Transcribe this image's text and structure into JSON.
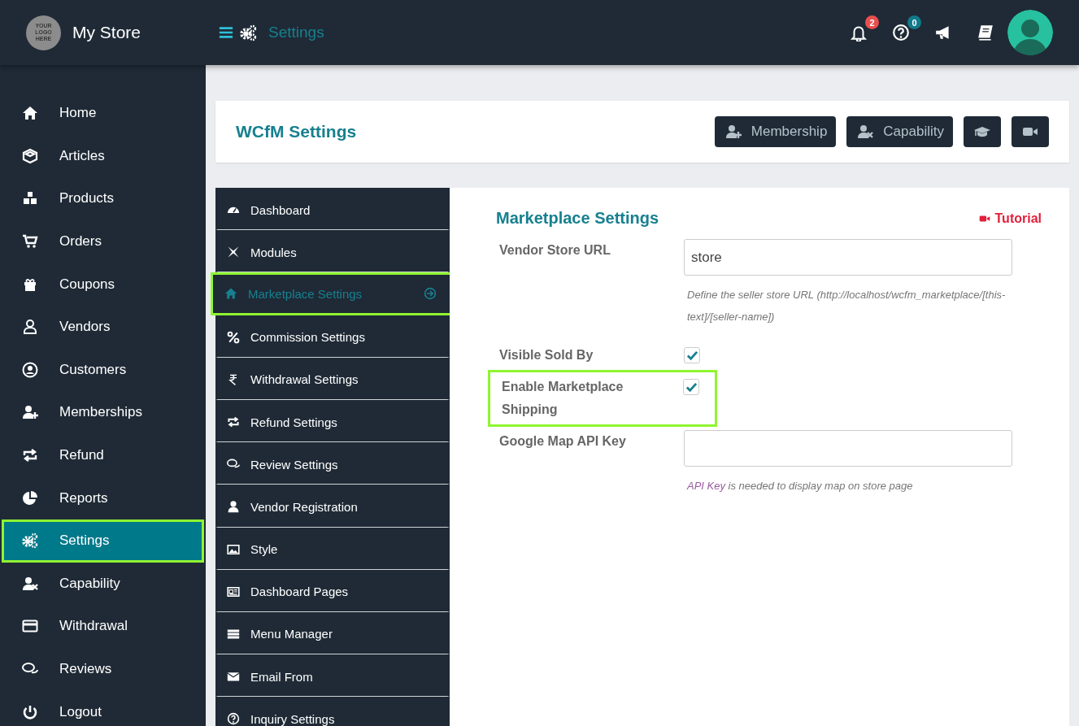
{
  "topbar": {
    "logo_text": "YOUR LOGO HERE",
    "store_name": "My Store",
    "page_title": "Settings",
    "notifications": [
      {
        "badge": "2",
        "color": "#e84f4f"
      },
      {
        "badge": "0",
        "color": "#117a8b"
      }
    ]
  },
  "sidebar": {
    "items": [
      {
        "label": "Home",
        "selected": false,
        "highlighted": false
      },
      {
        "label": "Articles",
        "selected": false,
        "highlighted": false
      },
      {
        "label": "Products",
        "selected": false,
        "highlighted": false
      },
      {
        "label": "Orders",
        "selected": false,
        "highlighted": false
      },
      {
        "label": "Coupons",
        "selected": false,
        "highlighted": false
      },
      {
        "label": "Vendors",
        "selected": false,
        "highlighted": false
      },
      {
        "label": "Customers",
        "selected": false,
        "highlighted": false
      },
      {
        "label": "Memberships",
        "selected": false,
        "highlighted": false
      },
      {
        "label": "Refund",
        "selected": false,
        "highlighted": false
      },
      {
        "label": "Reports",
        "selected": false,
        "highlighted": false
      },
      {
        "label": "Settings",
        "selected": true,
        "highlighted": true
      },
      {
        "label": "Capability",
        "selected": false,
        "highlighted": false
      },
      {
        "label": "Withdrawal",
        "selected": false,
        "highlighted": false
      },
      {
        "label": "Reviews",
        "selected": false,
        "highlighted": false
      },
      {
        "label": "Logout",
        "selected": false,
        "highlighted": false
      }
    ]
  },
  "header": {
    "title": "WCfM Settings",
    "buttons": [
      {
        "label": "Membership"
      },
      {
        "label": "Capability"
      }
    ]
  },
  "settings_nav": {
    "items": [
      {
        "label": "Dashboard",
        "selected": false,
        "highlighted": false
      },
      {
        "label": "Modules",
        "selected": false,
        "highlighted": false
      },
      {
        "label": "Marketplace Settings",
        "selected": true,
        "highlighted": true
      },
      {
        "label": "Commission Settings",
        "selected": false,
        "highlighted": false
      },
      {
        "label": "Withdrawal Settings",
        "selected": false,
        "highlighted": false
      },
      {
        "label": "Refund Settings",
        "selected": false,
        "highlighted": false
      },
      {
        "label": "Review Settings",
        "selected": false,
        "highlighted": false
      },
      {
        "label": "Vendor Registration",
        "selected": false,
        "highlighted": false
      },
      {
        "label": "Style",
        "selected": false,
        "highlighted": false
      },
      {
        "label": "Dashboard Pages",
        "selected": false,
        "highlighted": false
      },
      {
        "label": "Menu Manager",
        "selected": false,
        "highlighted": false
      },
      {
        "label": "Email From",
        "selected": false,
        "highlighted": false
      },
      {
        "label": "Inquiry Settings",
        "selected": false,
        "highlighted": false
      }
    ]
  },
  "panel": {
    "title": "Marketplace Settings",
    "tutorial": "Tutorial",
    "fields": [
      {
        "kind": "text",
        "label": "Vendor Store URL",
        "value": "store",
        "highlighted": false,
        "help": "Define the seller store URL (http://localhost/wcfm_marketplace/[this-text]/[seller-name])"
      },
      {
        "kind": "checkbox",
        "label": "Visible Sold By",
        "checked": true,
        "highlighted": false
      },
      {
        "kind": "checkbox",
        "label": "Enable Marketplace Shipping",
        "checked": true,
        "highlighted": true
      },
      {
        "kind": "text",
        "label": "Google Map API Key",
        "highlighted": false,
        "help_link": "API Key",
        "help": " is needed to display map on store page"
      }
    ]
  }
}
